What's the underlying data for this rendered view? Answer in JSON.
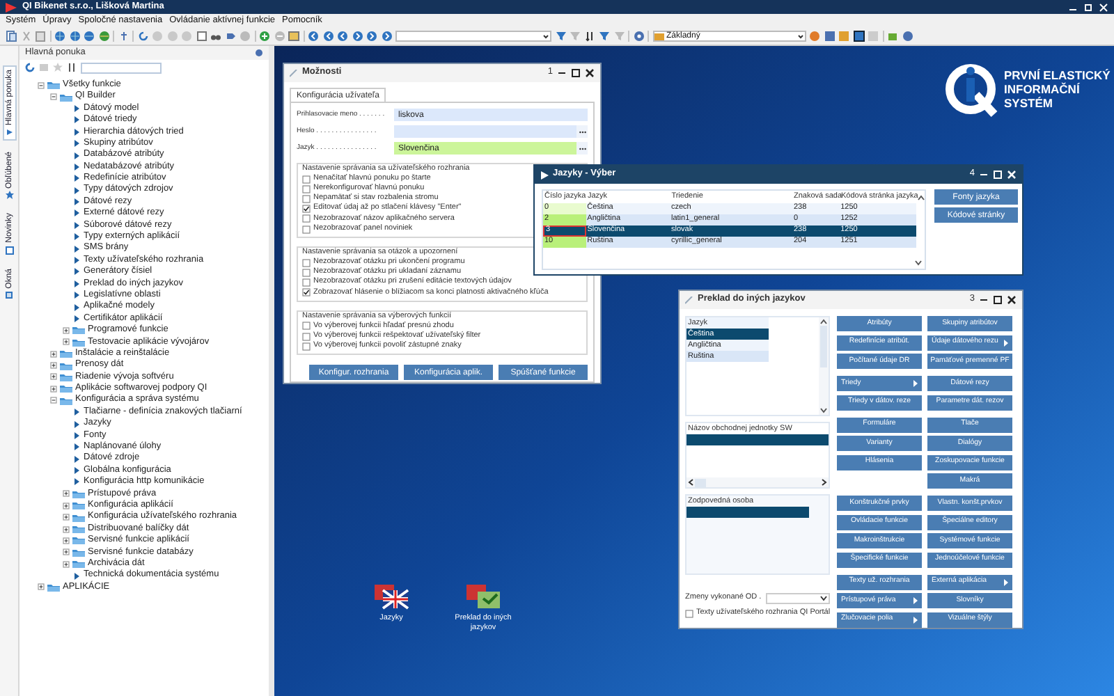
{
  "window": {
    "title": "QI  Bikenet s.r.o., Lišková Martina"
  },
  "menu": [
    "Systém",
    "Úpravy",
    "Spoločné nastavenia",
    "Ovládanie aktívnej funkcie",
    "Pomocník"
  ],
  "toolbar": {
    "profile": "Základný"
  },
  "side_tabs": [
    {
      "label": "Hlavná ponuka",
      "selected": true
    },
    {
      "label": "Obľúbené",
      "selected": false
    },
    {
      "label": "Novinky",
      "selected": false
    },
    {
      "label": "Okná",
      "selected": false
    }
  ],
  "main_menu": {
    "title": "Hlavná ponuka",
    "tree": [
      {
        "label": "Všetky funkcie",
        "kind": "folder",
        "expanded": true,
        "children": [
          {
            "label": "QI Builder",
            "kind": "folder",
            "expanded": true,
            "children": [
              {
                "label": "Dátový model",
                "kind": "item"
              },
              {
                "label": "Dátové triedy",
                "kind": "item"
              },
              {
                "label": "Hierarchia dátových tried",
                "kind": "item"
              },
              {
                "label": "Skupiny atribútov",
                "kind": "item"
              },
              {
                "label": "Databázové atribúty",
                "kind": "item"
              },
              {
                "label": "Nedatabázové atribúty",
                "kind": "item"
              },
              {
                "label": "Redefinície atribútov",
                "kind": "item"
              },
              {
                "label": "Typy dátových zdrojov",
                "kind": "item"
              },
              {
                "label": "Dátové rezy",
                "kind": "item"
              },
              {
                "label": "Externé dátové rezy",
                "kind": "item"
              },
              {
                "label": "Súborové dátové rezy",
                "kind": "item"
              },
              {
                "label": "Typy externých aplikácií",
                "kind": "item"
              },
              {
                "label": "SMS brány",
                "kind": "item"
              },
              {
                "label": "Texty užívateľského rozhrania",
                "kind": "item"
              },
              {
                "label": "Generátory čísiel",
                "kind": "item"
              },
              {
                "label": "Preklad do iných jazykov",
                "kind": "item"
              },
              {
                "label": "Legislatívne oblasti",
                "kind": "item"
              },
              {
                "label": "Aplikačné modely",
                "kind": "item"
              },
              {
                "label": "Certifikátor aplikácií",
                "kind": "item"
              },
              {
                "label": "Programové funkcie",
                "kind": "folder",
                "expanded": false
              },
              {
                "label": "Testovacie aplikácie vývojárov",
                "kind": "folder",
                "expanded": false
              }
            ]
          },
          {
            "label": "Inštalácie a reinštalácie",
            "kind": "folder",
            "expanded": false
          },
          {
            "label": "Prenosy dát",
            "kind": "folder",
            "expanded": false
          },
          {
            "label": "Riadenie vývoja softvéru",
            "kind": "folder",
            "expanded": false
          },
          {
            "label": "Aplikácie softwarovej podpory QI",
            "kind": "folder",
            "expanded": false
          },
          {
            "label": "Konfigurácia a správa systému",
            "kind": "folder",
            "expanded": true,
            "children": [
              {
                "label": "Tlačiarne - definícia znakových tlačiarní",
                "kind": "item"
              },
              {
                "label": "Jazyky",
                "kind": "item"
              },
              {
                "label": "Fonty",
                "kind": "item"
              },
              {
                "label": "Naplánované úlohy",
                "kind": "item"
              },
              {
                "label": "Dátové zdroje",
                "kind": "item"
              },
              {
                "label": "Globálna konfigurácia",
                "kind": "item"
              },
              {
                "label": "Konfigurácia http komunikácie",
                "kind": "item"
              },
              {
                "label": "Prístupové práva",
                "kind": "folder",
                "expanded": false
              },
              {
                "label": "Konfigurácia aplikácií",
                "kind": "folder",
                "expanded": false
              },
              {
                "label": "Konfigurácia užívateľského rozhrania",
                "kind": "folder",
                "expanded": false
              },
              {
                "label": "Distribuované balíčky dát",
                "kind": "folder",
                "expanded": false
              },
              {
                "label": "Servisné funkcie aplikácií",
                "kind": "folder",
                "expanded": false
              },
              {
                "label": "Servisné funkcie databázy",
                "kind": "folder",
                "expanded": false
              },
              {
                "label": "Archivácia dát",
                "kind": "folder",
                "expanded": false
              },
              {
                "label": "Technická dokumentácia systému",
                "kind": "item"
              }
            ]
          }
        ]
      },
      {
        "label": "APLIKÁCIE",
        "kind": "folder",
        "expanded": false
      }
    ]
  },
  "logo": {
    "lines": [
      "PRVNÍ ELASTICKÝ",
      "INFORMAČNÍ",
      "SYSTÉM"
    ]
  },
  "options_dialog": {
    "title": "Možnosti",
    "number": "1",
    "tab": "Konfigurácia užívateľa",
    "fields": [
      {
        "label": "Prihlasovacie meno . . . . . . .",
        "value": "liskova",
        "required": false,
        "browse": false
      },
      {
        "label": "Heslo . . . . . . . . . . . . . . . .",
        "required": false,
        "browse": true
      },
      {
        "label": "Jazyk . . . . . . . . . . . . . . . .",
        "value": "Slovenčina",
        "required": true,
        "browse": true
      }
    ],
    "groups": [
      {
        "title": "Nastavenie správania sa užívateľského rozhrania",
        "options": [
          {
            "label": "Nenačítať hlavnú ponuku po štarte",
            "checked": false
          },
          {
            "label": "Nerekonfigurovať hlavnú ponuku",
            "checked": false
          },
          {
            "label": "Nepamätať si stav rozbalenia stromu",
            "checked": false
          },
          {
            "label": "Editovať údaj až po stlačení klávesy \"Enter\"",
            "checked": true
          },
          {
            "label": "Nezobrazovať názov aplikačného servera",
            "checked": false
          },
          {
            "label": "Nezobrazovať panel noviniek",
            "checked": false
          }
        ]
      },
      {
        "title": "Nastavenie správania sa otázok a upozornení",
        "options": [
          {
            "label": "Nezobrazovať otázku pri ukončení programu",
            "checked": false
          },
          {
            "label": "Nezobrazovať otázku pri ukladaní záznamu",
            "checked": false
          },
          {
            "label": "Nezobrazovať otázku pri zrušení editácie textových údajov",
            "checked": false
          },
          {
            "label": "Zobrazovať hlásenie o blížiacom sa konci platnosti aktivačného kľúča",
            "checked": true
          }
        ]
      },
      {
        "title": "Nastavenie správania sa výberových funkcií",
        "options": [
          {
            "label": "Vo výberovej funkcii hľadať presnú zhodu",
            "checked": false
          },
          {
            "label": "Vo výberovej funkcii rešpektovať užívateľský filter",
            "checked": false
          },
          {
            "label": "Vo výberovej funkcii povoliť zástupné znaky",
            "checked": false
          }
        ]
      }
    ],
    "buttons": [
      "Konfigur. rozhrania",
      "Konfigurácia aplik.",
      "Spúšťané funkcie"
    ]
  },
  "language_picker": {
    "title": "Jazyky - Výber",
    "number": "4",
    "columns": [
      "Číslo jazyka",
      "Jazyk",
      "Triedenie",
      "Znaková sada",
      "Kódová stránka jazyka"
    ],
    "rows": [
      {
        "cells": [
          "0",
          "Čeština",
          "czech",
          "238",
          "1250"
        ],
        "selected": false
      },
      {
        "cells": [
          "2",
          "Angličtina",
          "latin1_general",
          "0",
          "1252"
        ],
        "selected": false
      },
      {
        "cells": [
          "3",
          "Slovenčina",
          "slovak",
          "238",
          "1250"
        ],
        "selected": true
      },
      {
        "cells": [
          "10",
          "Ruština",
          "cyrillic_general",
          "204",
          "1251"
        ],
        "selected": false
      }
    ],
    "buttons": [
      "Fonty jazyka",
      "Kódové stránky"
    ]
  },
  "translation_dialog": {
    "title": "Preklad do iných jazykov",
    "number": "3",
    "language_list": {
      "header": "Jazyk",
      "items": [
        {
          "label": "Čeština",
          "selected": true
        },
        {
          "label": "Angličtina",
          "selected": false
        },
        {
          "label": "Ruština",
          "selected": false
        }
      ]
    },
    "unit_list": {
      "header": "Názov obchodnej jednotky SW"
    },
    "person_list": {
      "header": "Zodpovedná osoba"
    },
    "changes_label": "Zmeny vykonané OD  .",
    "portal_option": {
      "label": "Texty užívateľského rozhrania QI Portál",
      "checked": false
    },
    "button_groups": [
      [
        {
          "left": {
            "label": "Atribúty",
            "submenu": false
          },
          "right": {
            "label": "Skupiny atribútov",
            "submenu": false
          }
        },
        {
          "left": {
            "label": "Redefinície atribút.",
            "submenu": false
          },
          "right": {
            "label": "Údaje dátového rezu",
            "submenu": true
          }
        },
        {
          "left": {
            "label": "Počítané údaje DR",
            "submenu": false
          },
          "right": {
            "label": "Pamäťové premenné PF",
            "submenu": false
          }
        }
      ],
      [
        {
          "left": {
            "label": "Triedy",
            "submenu": true
          },
          "right": {
            "label": "Dátové rezy",
            "submenu": false
          }
        },
        {
          "left": {
            "label": "Triedy v dátov. reze",
            "submenu": false
          },
          "right": {
            "label": "Parametre dát. rezov",
            "submenu": false
          }
        }
      ],
      [
        {
          "left": {
            "label": "Formuláre",
            "submenu": false
          },
          "right": {
            "label": "Tlače",
            "submenu": false
          }
        },
        {
          "left": {
            "label": "Varianty",
            "submenu": false
          },
          "right": {
            "label": "Dialógy",
            "submenu": false
          }
        },
        {
          "left": {
            "label": "Hlásenia",
            "submenu": false
          },
          "right": {
            "label": "Zoskupovacie funkcie",
            "submenu": false
          }
        },
        {
          "right": {
            "label": "Makrá",
            "submenu": false
          }
        }
      ],
      [
        {
          "left": {
            "label": "Konštrukčné prvky",
            "submenu": false
          },
          "right": {
            "label": "Vlastn. konšt.prvkov",
            "submenu": false
          }
        },
        {
          "left": {
            "label": "Ovládacie funkcie",
            "submenu": false
          },
          "right": {
            "label": "Špeciálne editory",
            "submenu": false
          }
        },
        {
          "left": {
            "label": "Makroinštrukcie",
            "submenu": false
          },
          "right": {
            "label": "Systémové funkcie",
            "submenu": false
          }
        },
        {
          "left": {
            "label": "Špecifické funkcie",
            "submenu": false
          },
          "right": {
            "label": "Jednoúčelové funkcie",
            "submenu": false
          }
        }
      ],
      [
        {
          "left": {
            "label": "Texty už. rozhrania",
            "submenu": false
          },
          "right": {
            "label": "Externá aplikácia",
            "submenu": true
          }
        },
        {
          "left": {
            "label": "Prístupové práva",
            "submenu": true
          },
          "right": {
            "label": "Slovníky",
            "submenu": false
          }
        },
        {
          "left": {
            "label": "Zlučovacie polia",
            "submenu": true
          },
          "right": {
            "label": "Vizuálne štýly",
            "submenu": false
          }
        }
      ]
    ]
  },
  "desktop_icons": [
    {
      "label": "Jazyky"
    },
    {
      "label": "Preklad do iných jazykov"
    }
  ]
}
